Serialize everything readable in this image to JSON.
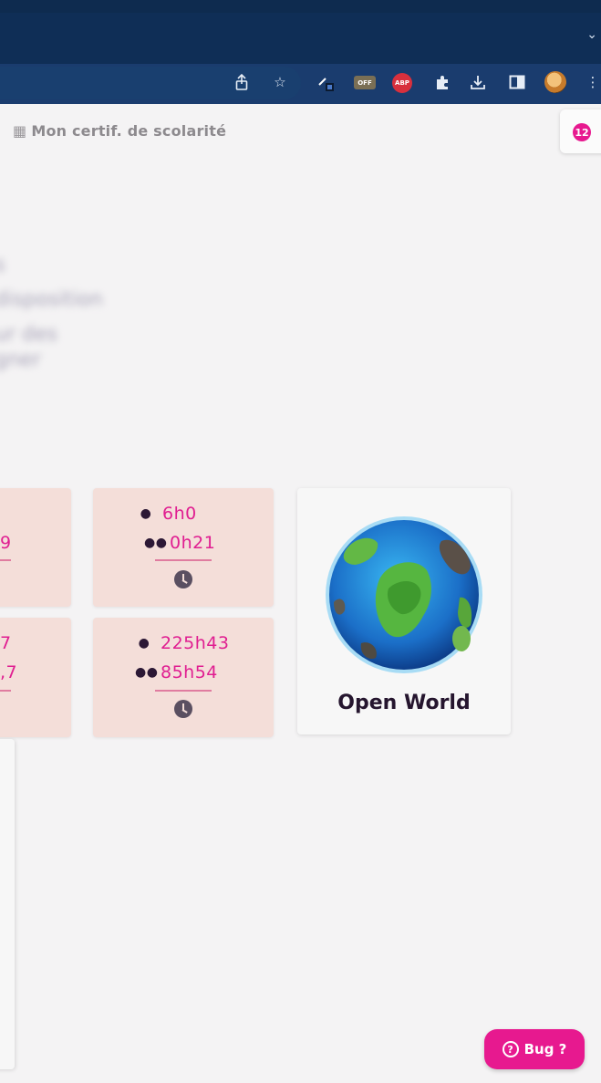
{
  "browser": {
    "tab_menu_icon": "chevron-down-icon",
    "toolbar_icons": [
      "share-icon",
      "bookmark-star-icon",
      "pen-extension-icon",
      "off-extension-icon",
      "adblock-plus-icon",
      "extensions-puzzle-icon",
      "download-icon",
      "side-panel-icon",
      "profile-avatar-icon",
      "more-menu-icon"
    ],
    "ext_off_label": "OFF",
    "ext_abp_label": "ABP"
  },
  "header": {
    "certificate_link": "Mon certif. de scolarité",
    "certificate_icon": "building-icon",
    "notification_count": "12"
  },
  "blurred_lines": [
    "s",
    "disposition",
    "ur des",
    "gner"
  ],
  "cards": {
    "partial_top": "9",
    "partial_bottom_a": "7",
    "partial_bottom_b": ",7",
    "top": {
      "solo": "6h0",
      "group": "0h21"
    },
    "bottom": {
      "solo": "225h43",
      "group": "85h54"
    }
  },
  "world": {
    "title": "Open World",
    "icon": "globe-icon"
  },
  "bug_button": {
    "label": "Bug ?",
    "icon": "question-circle-icon"
  },
  "colors": {
    "accent": "#e7198f",
    "chrome_dark": "#0f2e56",
    "card_bg": "#f4ded9",
    "title_dark": "#25152e"
  }
}
